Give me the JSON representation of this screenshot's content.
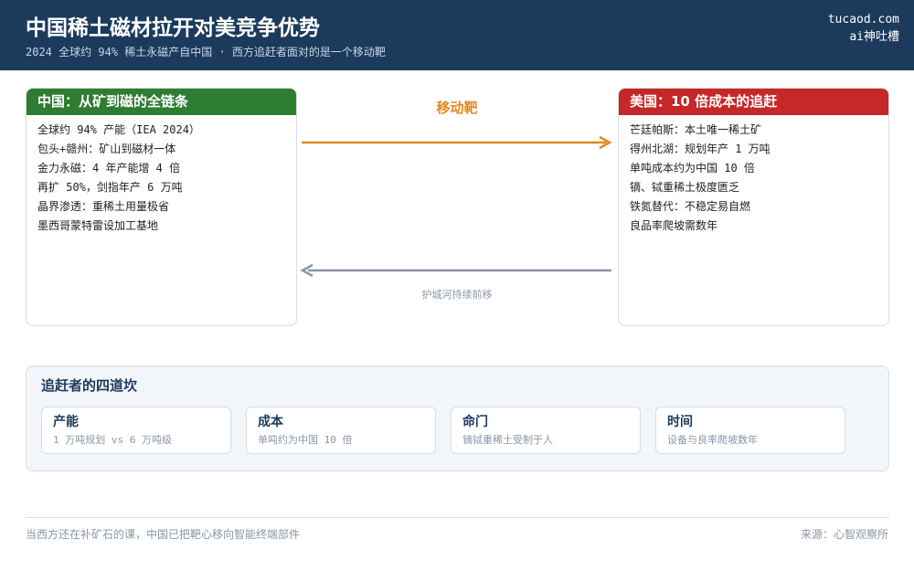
{
  "header": {
    "title": "中国稀土磁材拉开对美竞争优势",
    "subtitle": "2024 全球约 94% 稀土永磁产自中国 · 西方追赶者面对的是一个移动靶",
    "brand_line1": "tucaod.com",
    "brand_line2": "ai神吐槽"
  },
  "china_panel": {
    "title": "中国：从矿到磁的全链条",
    "items": [
      "全球约 94% 产能（IEA 2024）",
      "包头+赣州：矿山到磁材一体",
      "金力永磁：4 年产能增 4 倍",
      "再扩 50%，剑指年产 6 万吨",
      "晶界渗透：重稀土用量极省",
      "墨西哥蒙特雷设加工基地"
    ],
    "color": "#2e7d32"
  },
  "us_panel": {
    "title": "美国：10 倍成本的追赶",
    "items": [
      "芒廷帕斯：本土唯一稀土矿",
      "得州北湖：规划年产 1 万吨",
      "单吨成本约为中国 10 倍",
      "镝、铽重稀土极度匮乏",
      "铁氮替代：不稳定易自燃",
      "良品率爬坡需数年"
    ],
    "color": "#c62828"
  },
  "flow": {
    "top_label": "移动靶",
    "bottom_label": "护城河持续前移",
    "top_color": "#e08a1e",
    "bottom_color": "#8a96a6"
  },
  "hurdles": {
    "title": "追赶者的四道坎",
    "cards": [
      {
        "title": "产能",
        "desc": "1 万吨规划 vs 6 万吨级"
      },
      {
        "title": "成本",
        "desc": "单吨约为中国 10 倍"
      },
      {
        "title": "命门",
        "desc": "镝铽重稀土受制于人"
      },
      {
        "title": "时间",
        "desc": "设备与良率爬坡数年"
      }
    ]
  },
  "footer": {
    "left": "当西方还在补矿石的课，中国已把靶心移向智能终端部件",
    "right": "来源：心智观察所"
  },
  "colors": {
    "header_bg": "#1b3a5c",
    "china": "#2e7d32",
    "us": "#c62828",
    "accent": "#e08a1e"
  }
}
